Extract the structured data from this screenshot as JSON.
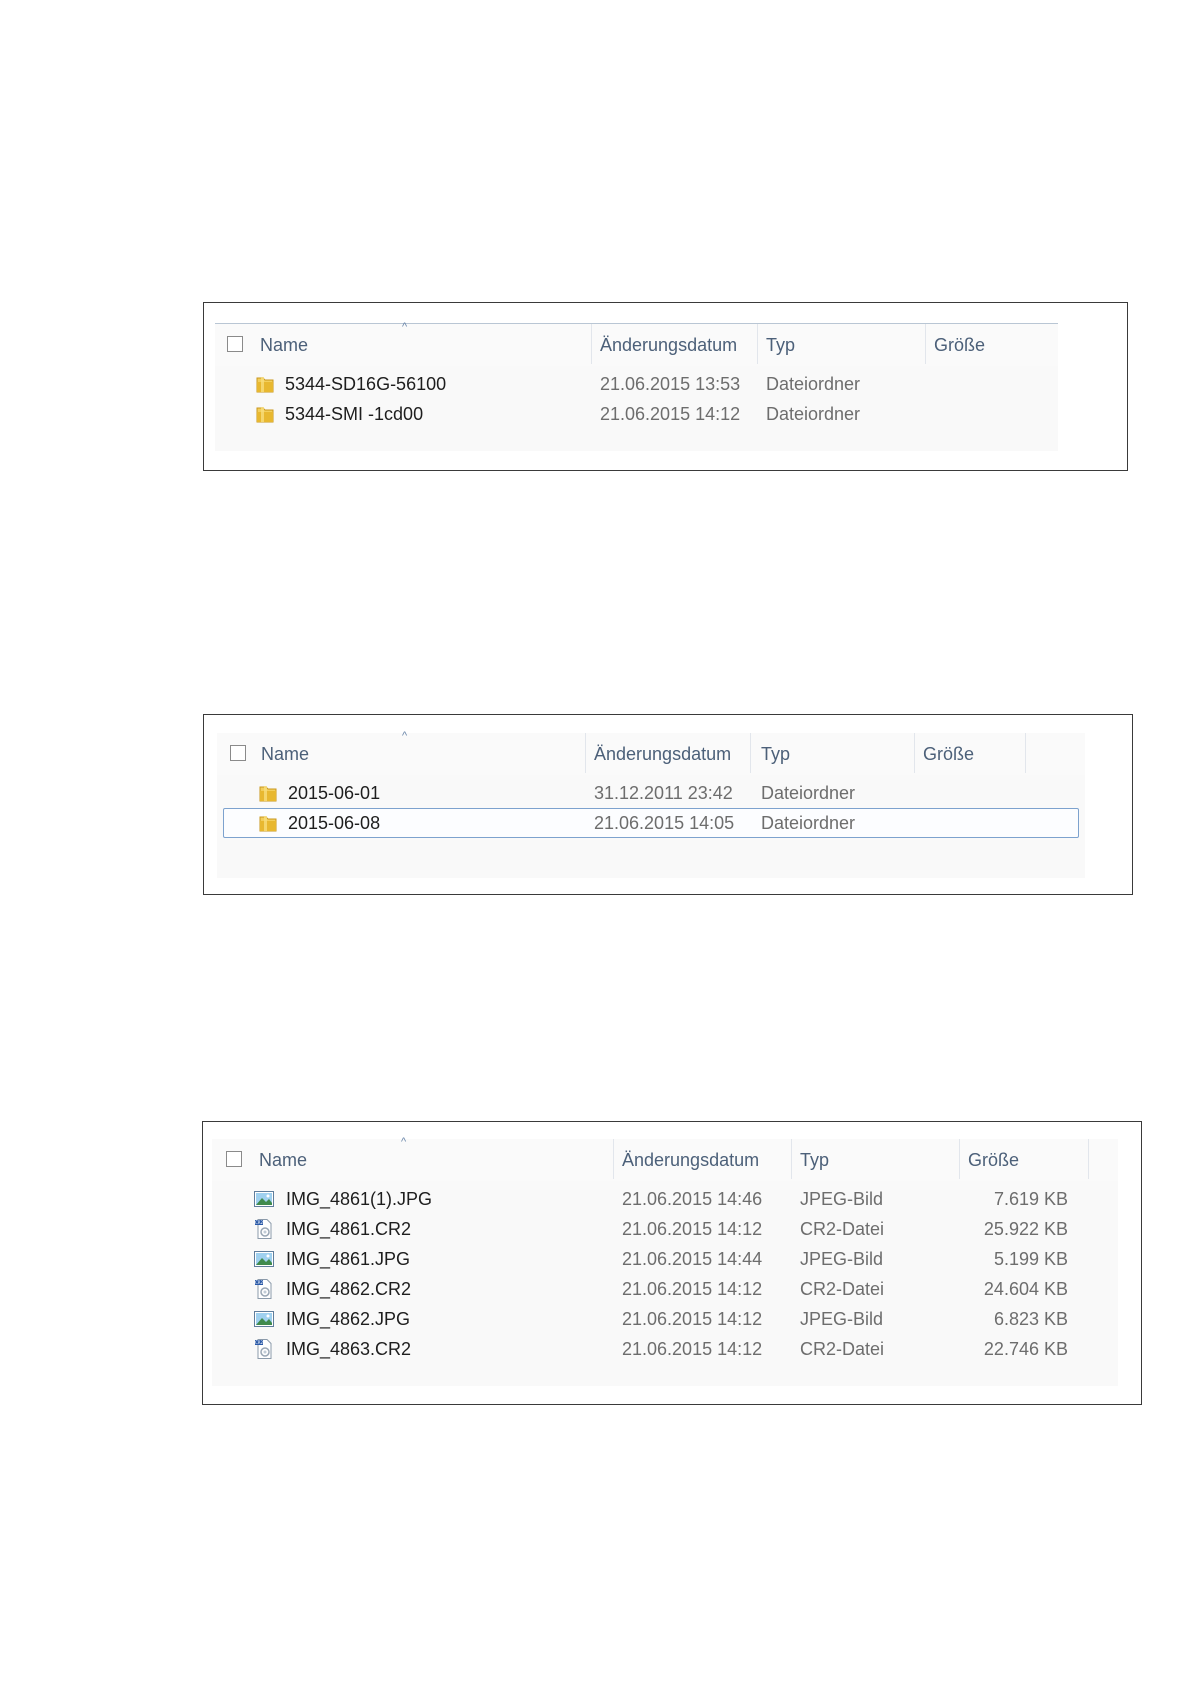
{
  "panels": [
    {
      "columns": {
        "name": "Name",
        "date": "Änderungsdatum",
        "type": "Typ",
        "size": "Größe"
      },
      "rows": [
        {
          "icon": "folder-icon",
          "name": "5344-SD16G-56100",
          "date": "21.06.2015 13:53",
          "type": "Dateiordner",
          "size": ""
        },
        {
          "icon": "folder-icon",
          "name": "5344-SMI  -1cd00",
          "date": "21.06.2015 14:12",
          "type": "Dateiordner",
          "size": ""
        }
      ]
    },
    {
      "columns": {
        "name": "Name",
        "date": "Änderungsdatum",
        "type": "Typ",
        "size": "Größe"
      },
      "rows": [
        {
          "icon": "folder-icon",
          "name": "2015-06-01",
          "date": "31.12.2011 23:42",
          "type": "Dateiordner",
          "size": ""
        },
        {
          "icon": "folder-icon",
          "name": "2015-06-08",
          "date": "21.06.2015 14:05",
          "type": "Dateiordner",
          "size": "",
          "selected": true
        }
      ]
    },
    {
      "columns": {
        "name": "Name",
        "date": "Änderungsdatum",
        "type": "Typ",
        "size": "Größe"
      },
      "rows": [
        {
          "icon": "jpeg-image-icon",
          "name": "IMG_4861(1).JPG",
          "date": "21.06.2015 14:46",
          "type": "JPEG-Bild",
          "size": "7.619 KB"
        },
        {
          "icon": "cr2-file-icon",
          "name": "IMG_4861.CR2",
          "date": "21.06.2015 14:12",
          "type": "CR2-Datei",
          "size": "25.922 KB"
        },
        {
          "icon": "jpeg-image-icon",
          "name": "IMG_4861.JPG",
          "date": "21.06.2015 14:44",
          "type": "JPEG-Bild",
          "size": "5.199 KB"
        },
        {
          "icon": "cr2-file-icon",
          "name": "IMG_4862.CR2",
          "date": "21.06.2015 14:12",
          "type": "CR2-Datei",
          "size": "24.604 KB"
        },
        {
          "icon": "jpeg-image-icon",
          "name": "IMG_4862.JPG",
          "date": "21.06.2015 14:12",
          "type": "JPEG-Bild",
          "size": "6.823 KB"
        },
        {
          "icon": "cr2-file-icon",
          "name": "IMG_4863.CR2",
          "date": "21.06.2015 14:12",
          "type": "CR2-Datei",
          "size": "22.746 KB"
        }
      ]
    }
  ],
  "colors": {
    "header_text": "#4c6079",
    "name_text": "#1e1e1e",
    "detail_text": "#6d6d6d",
    "selection_border": "#7da2ce",
    "folder": "#e8b830"
  }
}
